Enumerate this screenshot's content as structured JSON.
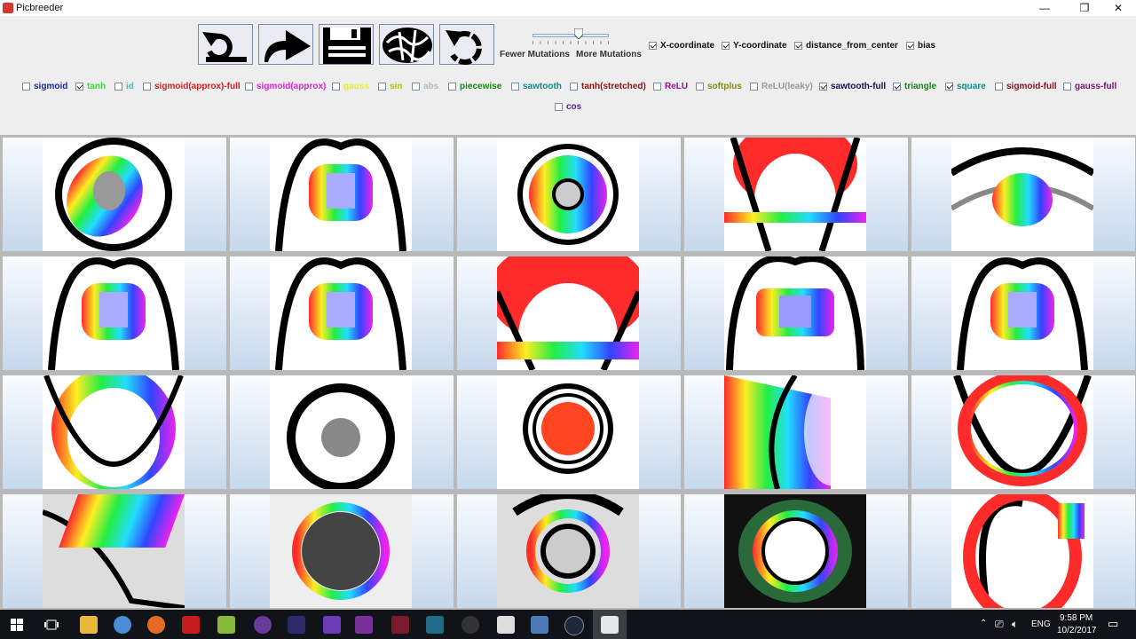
{
  "window": {
    "title": "Picbreeder",
    "minimize": "—",
    "maximize": "❐",
    "close": "✕"
  },
  "toolbar": {
    "buttons": [
      {
        "name": "reset-button",
        "icon": "reset-icon"
      },
      {
        "name": "evolve-button",
        "icon": "forward-arrow-icon"
      },
      {
        "name": "save-button",
        "icon": "floppy-disk-icon"
      },
      {
        "name": "network-button",
        "icon": "network-icon"
      },
      {
        "name": "undo-button",
        "icon": "undo-icon"
      }
    ],
    "fewer_mutations": "Fewer Mutations",
    "more_mutations": "More Mutations",
    "inputs": [
      {
        "label": "X-coordinate",
        "checked": true
      },
      {
        "label": "Y-coordinate",
        "checked": true
      },
      {
        "label": "distance_from_center",
        "checked": true
      },
      {
        "label": "bias",
        "checked": true
      }
    ],
    "activations": [
      {
        "label": "sigmoid",
        "checked": false,
        "color": "#1a2a9a"
      },
      {
        "label": "tanh",
        "checked": true,
        "color": "#33dd33"
      },
      {
        "label": "id",
        "checked": false,
        "color": "#33cccc"
      },
      {
        "label": "sigmoid(approx)-full",
        "checked": false,
        "color": "#cc2222"
      },
      {
        "label": "sigmoid(approx)",
        "checked": false,
        "color": "#dd22dd"
      },
      {
        "label": "gauss",
        "checked": false,
        "color": "#eeee22"
      },
      {
        "label": "sin",
        "checked": false,
        "color": "#bbbb00"
      },
      {
        "label": "abs",
        "checked": false,
        "color": "#bbbbbb"
      },
      {
        "label": "piecewise",
        "checked": false,
        "color": "#118811"
      },
      {
        "label": "sawtooth",
        "checked": false,
        "color": "#118888"
      },
      {
        "label": "tanh(stretched)",
        "checked": false,
        "color": "#881111"
      },
      {
        "label": "ReLU",
        "checked": false,
        "color": "#991199"
      },
      {
        "label": "softplus",
        "checked": false,
        "color": "#888811"
      },
      {
        "label": "ReLU(leaky)",
        "checked": false,
        "color": "#999999"
      },
      {
        "label": "sawtooth-full",
        "checked": true,
        "color": "#111155"
      },
      {
        "label": "triangle",
        "checked": true,
        "color": "#118811"
      },
      {
        "label": "square",
        "checked": true,
        "color": "#118888"
      },
      {
        "label": "sigmoid-full",
        "checked": false,
        "color": "#881122"
      },
      {
        "label": "gauss-full",
        "checked": false,
        "color": "#771177"
      },
      {
        "label": "cos",
        "checked": false,
        "color": "#552288"
      }
    ]
  },
  "taskbar": {
    "time": "9:58 PM",
    "date": "10/2/2017",
    "language": "ENG"
  },
  "colors": {
    "taskbar": "#101418",
    "grid_border": "#b9b9b9",
    "titlebar": "#ffffff"
  }
}
